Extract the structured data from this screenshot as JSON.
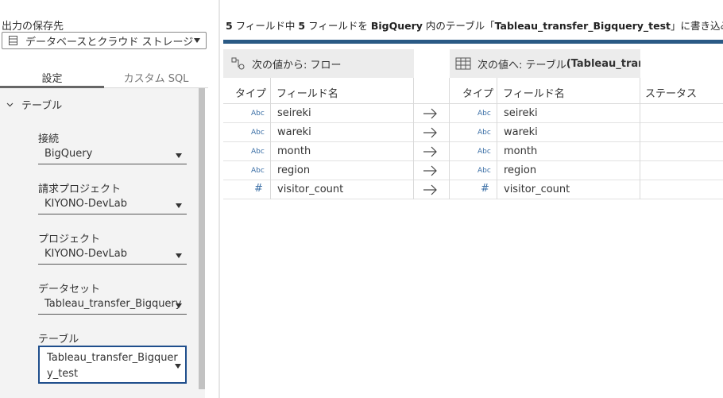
{
  "output": {
    "label": "出力の保存先",
    "selected": "データベースとクラウド ストレージ",
    "icon": "database-icon"
  },
  "tabs": [
    "設定",
    "カスタム SQL"
  ],
  "section": {
    "title": "テーブル",
    "icon": "chevron-down-icon"
  },
  "fields": {
    "connection": {
      "label": "接続",
      "value": "BigQuery"
    },
    "billing_project": {
      "label": "請求プロジェクト",
      "value": "KIYONO-DevLab"
    },
    "project": {
      "label": "プロジェクト",
      "value": "KIYONO-DevLab"
    },
    "dataset": {
      "label": "データセット",
      "value": "Tableau_transfer_Bigquery"
    },
    "table": {
      "label": "テーブル",
      "value_line1": "Tableau_transfer_Bigquer",
      "value_line2": "y_test"
    }
  },
  "header": {
    "count_a": "5",
    "text_a": " フィールド中 ",
    "count_b": "5",
    "text_b": " フィールドを ",
    "target": "BigQuery",
    "text_c": " 内のテーブル「",
    "table_name": "Tableau_transfer_Bigquery_test",
    "text_d": "」に書き込みます"
  },
  "colors": {
    "accent_bar": "#2a5a85",
    "type_icon": "#3a6ea5",
    "focus": "#1f4e8c"
  },
  "mapping": {
    "from_title": "次の値から: フロー",
    "to_title_prefix": "次の値へ: テーブル ",
    "to_title_bold": "(Tableau_transf...",
    "columns": {
      "type": "タイプ",
      "field_name": "フィールド名",
      "type2": "タイプ",
      "field_name2": "フィールド名",
      "status": "ステータス"
    },
    "rows": [
      {
        "type": "Abc",
        "source": "seireki",
        "target_type": "Abc",
        "target": "seireki",
        "status": ""
      },
      {
        "type": "Abc",
        "source": "wareki",
        "target_type": "Abc",
        "target": "wareki",
        "status": ""
      },
      {
        "type": "Abc",
        "source": "month",
        "target_type": "Abc",
        "target": "month",
        "status": ""
      },
      {
        "type": "Abc",
        "source": "region",
        "target_type": "Abc",
        "target": "region",
        "status": ""
      },
      {
        "type": "#",
        "source": "visitor_count",
        "target_type": "#",
        "target": "visitor_count",
        "status": ""
      }
    ]
  }
}
